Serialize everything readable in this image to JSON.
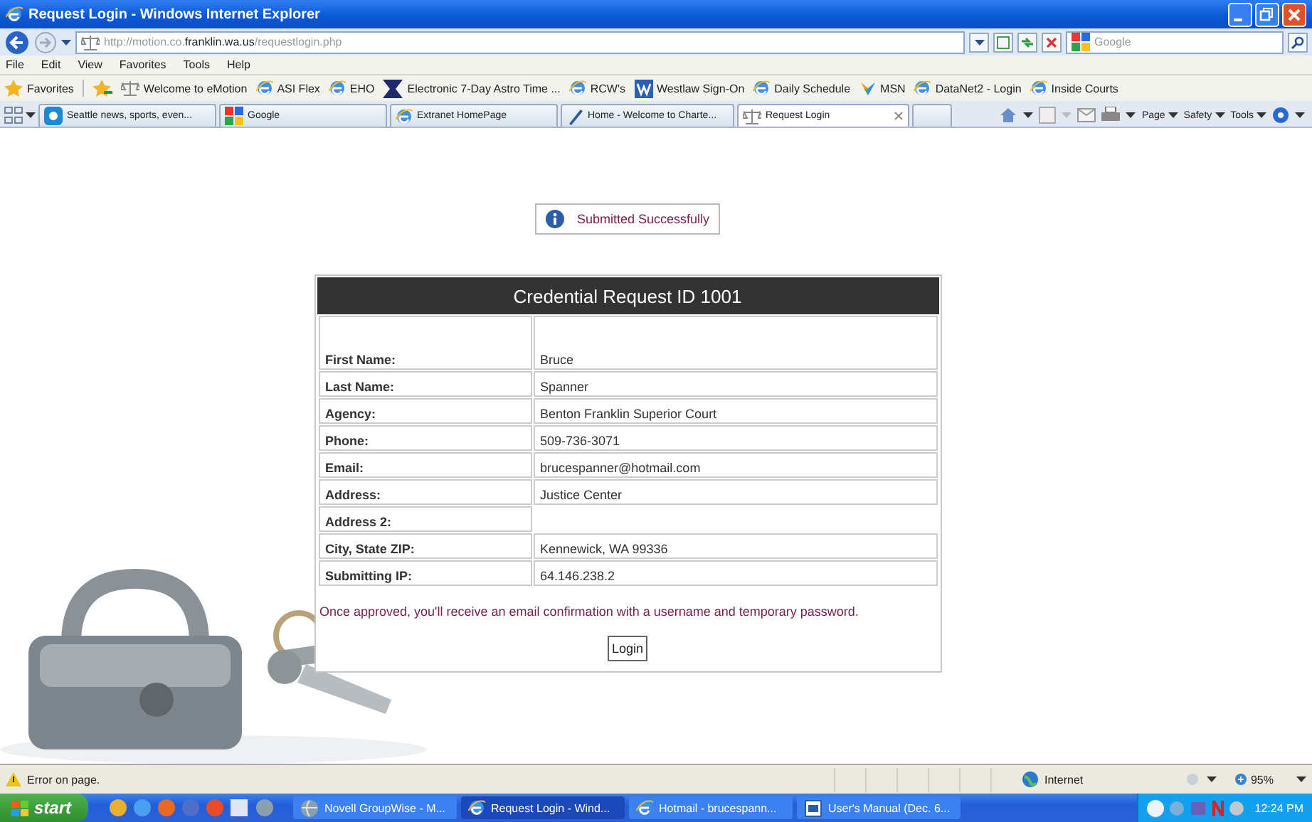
{
  "window": {
    "title": "Request Login - Windows Internet Explorer"
  },
  "address_bar": {
    "url": "http://motion.co.**franklin.wa.us**/requestlogin.php",
    "search_placeholder": "Google"
  },
  "menu": [
    "File",
    "Edit",
    "View",
    "Favorites",
    "Tools",
    "Help"
  ],
  "favorites_bar": {
    "label": "Favorites",
    "links": [
      {
        "label": "Welcome to eMotion",
        "kind": "scale"
      },
      {
        "label": "ASI Flex",
        "kind": "ie"
      },
      {
        "label": "EHO",
        "kind": "ie"
      },
      {
        "label": "Electronic 7-Day Astro Time ...",
        "kind": "hourglass"
      },
      {
        "label": "RCW's",
        "kind": "ie"
      },
      {
        "label": "Westlaw Sign-On",
        "kind": "w"
      },
      {
        "label": "Daily Schedule",
        "kind": "ie"
      },
      {
        "label": "MSN",
        "kind": "butterfly"
      },
      {
        "label": "DataNet2 - Login",
        "kind": "ie"
      },
      {
        "label": "Inside Courts",
        "kind": "ie"
      }
    ]
  },
  "tabs": [
    {
      "label": "Seattle news, sports, even...",
      "kind": "news",
      "selected": false
    },
    {
      "label": "Google",
      "kind": "google",
      "selected": false
    },
    {
      "label": "Extranet HomePage",
      "kind": "ie",
      "selected": false
    },
    {
      "label": "Home - Welcome to Charte...",
      "kind": "pen",
      "selected": false
    },
    {
      "label": "Request Login",
      "kind": "scale",
      "selected": true
    }
  ],
  "command_bar": [
    "Page",
    "Safety",
    "Tools"
  ],
  "notice": {
    "text": "Submitted Successfully"
  },
  "card": {
    "title": "Credential Request ID 1001",
    "rows": [
      {
        "label": "First Name:",
        "value": "Bruce"
      },
      {
        "label": "Last Name:",
        "value": "Spanner"
      },
      {
        "label": "Agency:",
        "value": "Benton Franklin Superior Court"
      },
      {
        "label": "Phone:",
        "value": "509-736-3071"
      },
      {
        "label": "Email:",
        "value": "brucespanner@hotmail.com"
      },
      {
        "label": "Address:",
        "value": "Justice Center"
      },
      {
        "label": "Address 2:"
      },
      {
        "label": "City, State ZIP:",
        "value": "Kennewick, WA 99336"
      },
      {
        "label": "Submitting IP:",
        "value": "64.146.238.2"
      }
    ],
    "message": "Once approved, you'll receive an email confirmation with a username and temporary password.",
    "button": "Login"
  },
  "status_bar": {
    "text": "Error on page.",
    "zone": "Internet",
    "zoom": "95%"
  },
  "taskbar": {
    "start": "start",
    "buttons": [
      {
        "label": "Novell GroupWise - M...",
        "kind": "globe",
        "selected": false
      },
      {
        "label": "Request Login - Wind...",
        "kind": "ie",
        "selected": true
      },
      {
        "label": "Hotmail - brucespann...",
        "kind": "ie",
        "selected": false
      },
      {
        "label": "User's Manual (Dec. 6...",
        "kind": "doc",
        "selected": false
      }
    ],
    "clock": "12:24 PM"
  }
}
